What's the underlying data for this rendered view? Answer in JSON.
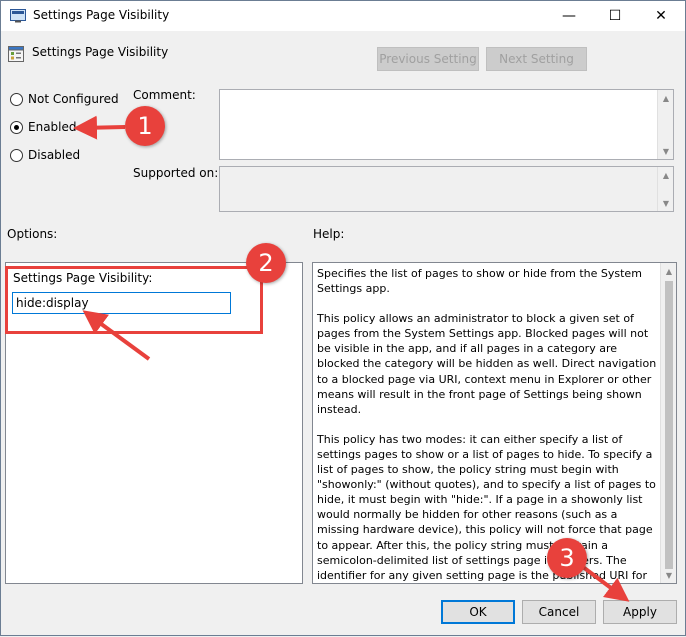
{
  "window": {
    "title": "Settings Page Visibility",
    "minimize": "—",
    "maximize": "☐",
    "close": "✕"
  },
  "policy": {
    "name": "Settings Page Visibility",
    "previous_label": "Previous Setting",
    "next_label": "Next Setting"
  },
  "state": {
    "not_configured": "Not Configured",
    "enabled": "Enabled",
    "disabled": "Disabled",
    "selected": "Enabled"
  },
  "labels": {
    "comment": "Comment:",
    "supported_on": "Supported on:",
    "options": "Options:",
    "help": "Help:"
  },
  "options": {
    "field_label": "Settings Page Visibility:",
    "field_value": "hide:display"
  },
  "help": {
    "p1": "Specifies the list of pages to show or hide from the System Settings app.",
    "p2": "This policy allows an administrator to block a given set of pages from the System Settings app. Blocked pages will not be visible in the app, and if all pages in a category are blocked the category will be hidden as well. Direct navigation to a blocked page via URI, context menu in Explorer or other means will result in the front page of Settings being shown instead.",
    "p3": "This policy has two modes: it can either specify a list of settings pages to show or a list of pages to hide. To specify a list of pages to show, the policy string must begin with \"showonly:\" (without quotes), and to specify a list of pages to hide, it must begin with \"hide:\". If a page in a showonly list would normally be hidden for other reasons (such as a missing hardware device), this policy will not force that page to appear. After this, the policy string must contain a semicolon-delimited list of settings page identifiers. The identifier for any given setting page is the published URI for that page, minus the \"ms-settings:\" protocol part."
  },
  "buttons": {
    "ok": "OK",
    "cancel": "Cancel",
    "apply": "Apply"
  },
  "callouts": {
    "step1": "1",
    "step2": "2",
    "step3": "3",
    "color": "#e8413c"
  },
  "colors": {
    "focus_blue": "#0078d7",
    "dialog_bg": "#f0f0f0"
  }
}
